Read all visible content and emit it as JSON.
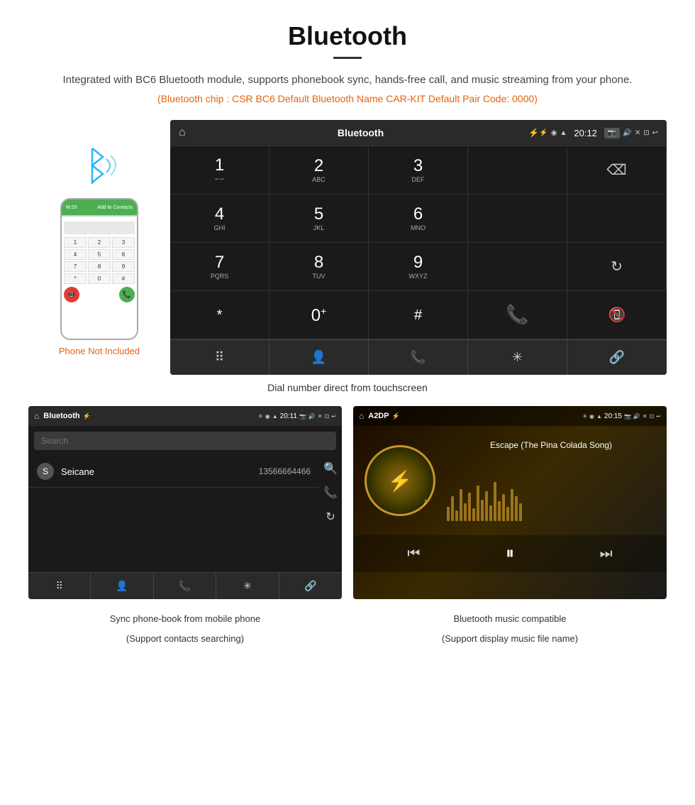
{
  "header": {
    "title": "Bluetooth",
    "description": "Integrated with BC6 Bluetooth module, supports phonebook sync, hands-free call, and music streaming from your phone.",
    "tech_specs": "(Bluetooth chip : CSR BC6   Default Bluetooth Name CAR-KIT    Default Pair Code: 0000)"
  },
  "phone_illustration": {
    "not_included_label": "Phone Not Included",
    "keypad_keys": [
      "1",
      "2",
      "3",
      "4",
      "5",
      "6",
      "7",
      "8",
      "9",
      "*",
      "0",
      "#"
    ]
  },
  "dial_screen": {
    "title": "Bluetooth",
    "time": "20:12",
    "rows": [
      {
        "num": "1",
        "sub": "∽∽",
        "num2": "2",
        "sub2": "ABC",
        "num3": "3",
        "sub3": "DEF"
      },
      {
        "num": "4",
        "sub": "GHI",
        "num2": "5",
        "sub2": "JKL",
        "num3": "6",
        "sub3": "MNO"
      },
      {
        "num": "7",
        "sub": "PQRS",
        "num2": "8",
        "sub2": "TUV",
        "num3": "9",
        "sub3": "WXYZ"
      },
      {
        "num": "*",
        "sub": "",
        "num2": "0",
        "sub2": "+",
        "num3": "#",
        "sub3": ""
      }
    ],
    "caption": "Dial number direct from touchscreen"
  },
  "phonebook_screen": {
    "title": "Bluetooth",
    "time": "20:11",
    "search_placeholder": "Search",
    "contact_initial": "S",
    "contact_name": "Seicane",
    "contact_number": "13566664466",
    "caption_line1": "Sync phone-book from mobile phone",
    "caption_line2": "(Support contacts searching)"
  },
  "music_screen": {
    "title": "A2DP",
    "time": "20:15",
    "song_title": "Escape (The Pina Colada Song)",
    "caption_line1": "Bluetooth music compatible",
    "caption_line2": "(Support display music file name)"
  }
}
